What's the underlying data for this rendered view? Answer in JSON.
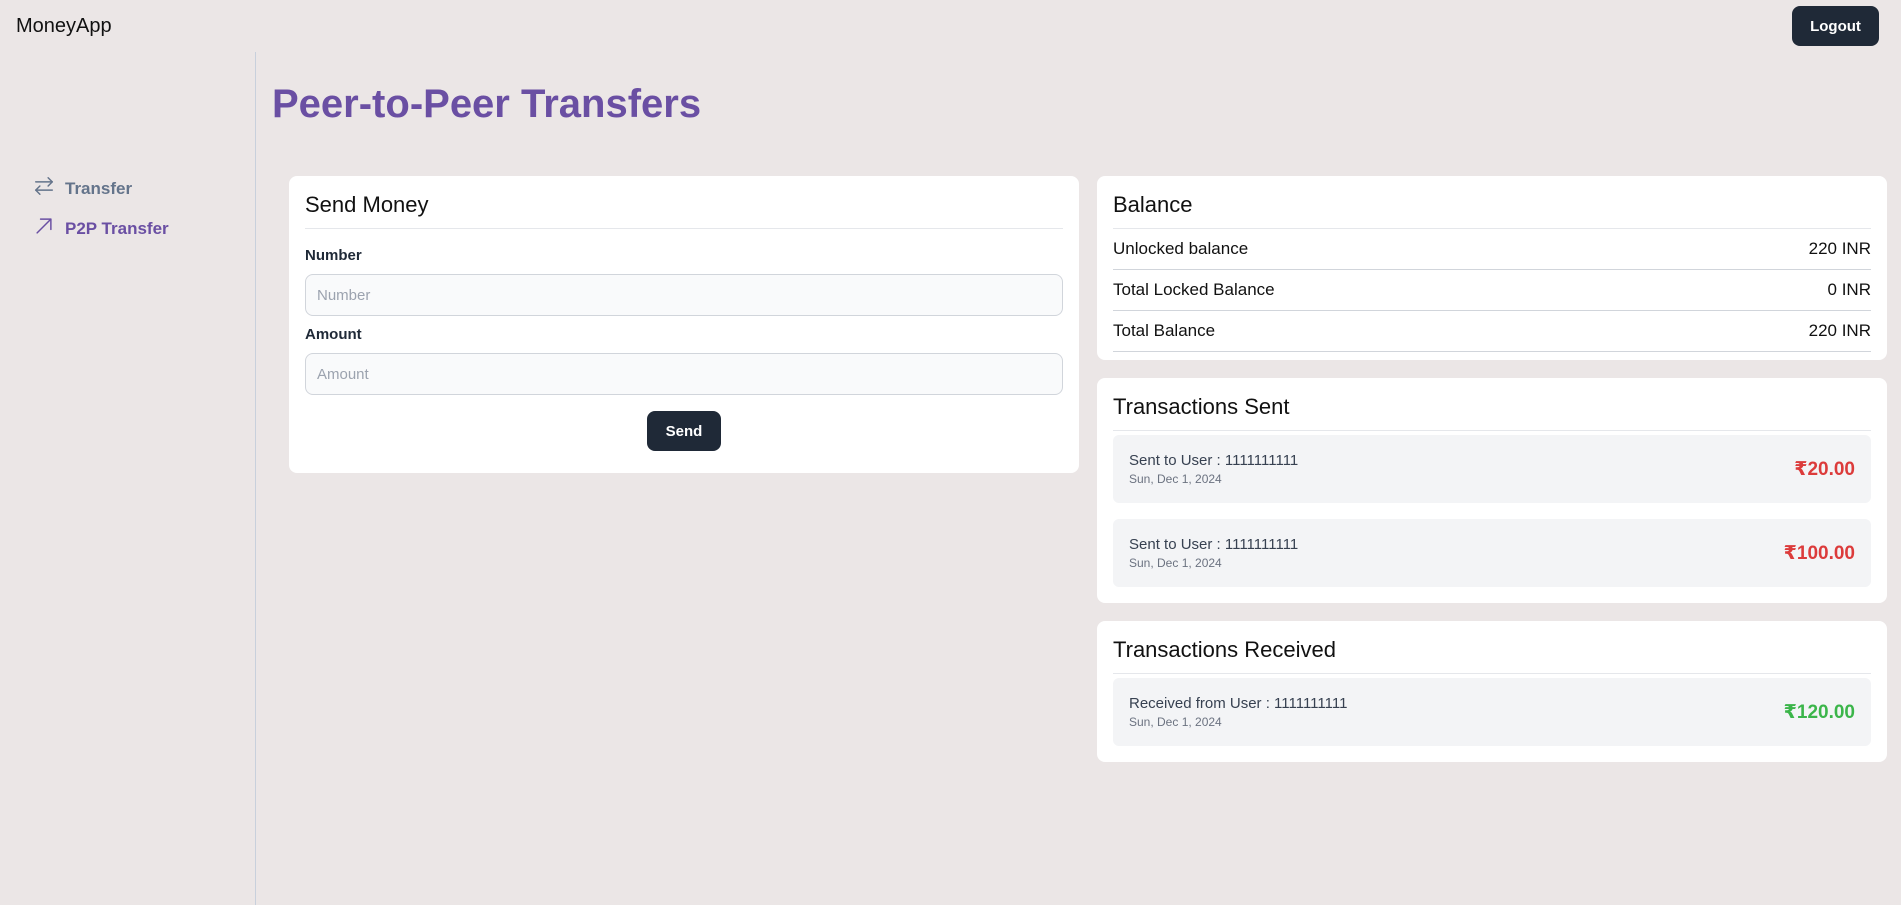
{
  "app": {
    "title": "MoneyApp",
    "logout_label": "Logout"
  },
  "sidebar": {
    "items": [
      {
        "label": "Transfer",
        "icon": "arrows-left-right-icon",
        "active": false
      },
      {
        "label": "P2P Transfer",
        "icon": "arrow-up-right-icon",
        "active": true
      }
    ]
  },
  "page": {
    "title": "Peer-to-Peer Transfers"
  },
  "send_money": {
    "title": "Send Money",
    "number_label": "Number",
    "number_placeholder": "Number",
    "number_value": "",
    "amount_label": "Amount",
    "amount_placeholder": "Amount",
    "amount_value": "",
    "send_label": "Send"
  },
  "balance": {
    "title": "Balance",
    "rows": [
      {
        "label": "Unlocked balance",
        "value": "220 INR"
      },
      {
        "label": "Total Locked Balance",
        "value": "0 INR"
      },
      {
        "label": "Total Balance",
        "value": "220 INR"
      }
    ]
  },
  "transactions_sent": {
    "title": "Transactions Sent",
    "items": [
      {
        "description": "Sent to User : 1111111111",
        "date": "Sun, Dec 1, 2024",
        "amount": "₹20.00"
      },
      {
        "description": "Sent to User : 1111111111",
        "date": "Sun, Dec 1, 2024",
        "amount": "₹100.00"
      }
    ]
  },
  "transactions_received": {
    "title": "Transactions Received",
    "items": [
      {
        "description": "Received from User : 1111111111",
        "date": "Sun, Dec 1, 2024",
        "amount": "₹120.00"
      }
    ]
  },
  "colors": {
    "accent": "#6a4fa3",
    "sent": "#dc3b3b",
    "received": "#3bb54a",
    "dark_button": "#1f2937"
  }
}
